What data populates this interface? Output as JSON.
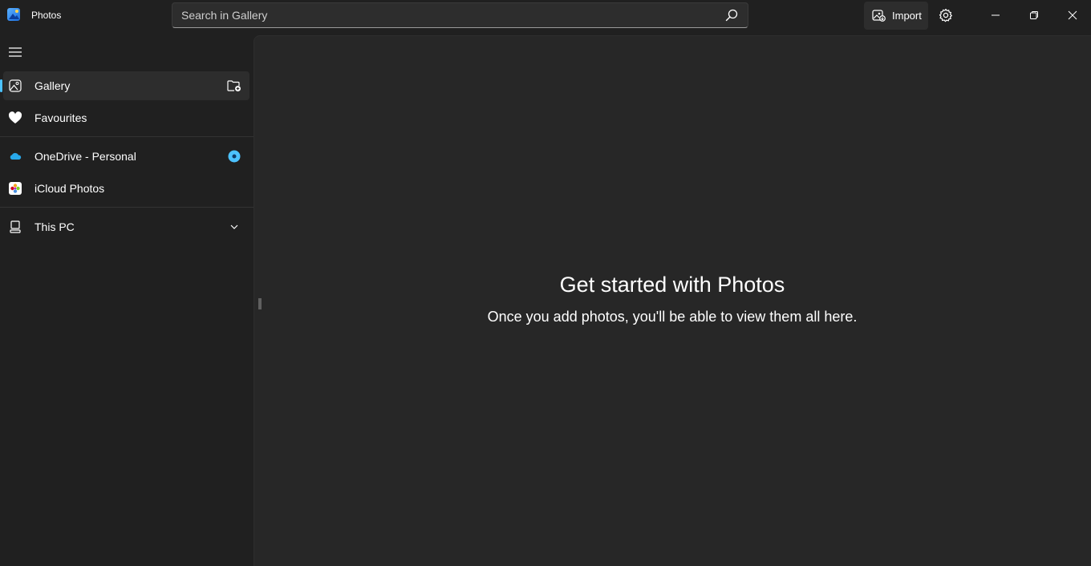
{
  "app": {
    "title": "Photos"
  },
  "search": {
    "placeholder": "Search in Gallery",
    "value": ""
  },
  "toolbar": {
    "import_label": "Import"
  },
  "sidebar": {
    "items": [
      {
        "label": "Gallery",
        "icon": "gallery-icon",
        "active": true,
        "trailing": "add-folder-icon"
      },
      {
        "label": "Favourites",
        "icon": "heart-icon"
      },
      {
        "label": "OneDrive - Personal",
        "icon": "onedrive-cloud-icon",
        "trailing": "onedrive-status-badge"
      },
      {
        "label": "iCloud Photos",
        "icon": "icloud-photos-icon"
      },
      {
        "label": "This PC",
        "icon": "pc-icon",
        "trailing": "chevron-down-icon"
      }
    ]
  },
  "main": {
    "empty_title": "Get started with Photos",
    "empty_subtitle": "Once you add photos, you'll be able to view them all here."
  },
  "colors": {
    "accent": "#4cc2ff",
    "background": "#202020",
    "content": "#272727"
  }
}
